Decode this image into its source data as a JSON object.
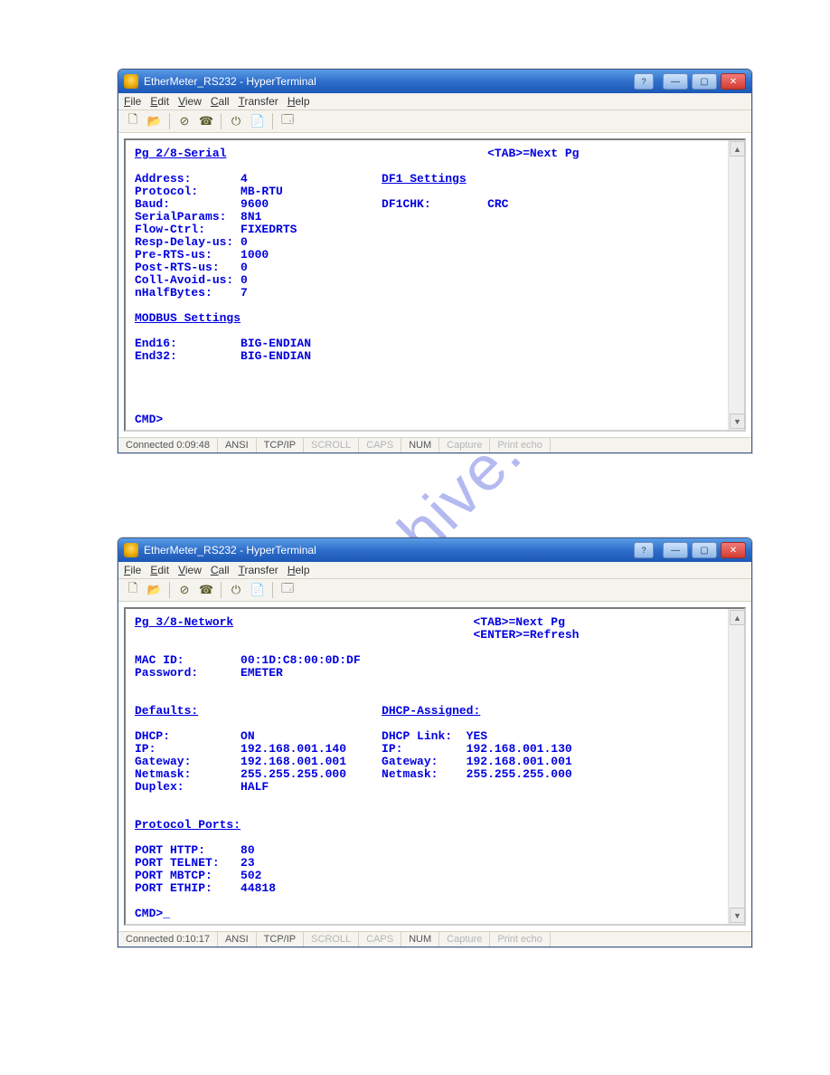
{
  "watermark": "manualshive.com",
  "menus": {
    "file": "File",
    "edit": "Edit",
    "view": "View",
    "call": "Call",
    "transfer": "Transfer",
    "help": "Help"
  },
  "window_controls": {
    "min": "—",
    "max": "▢",
    "close": "✕",
    "help": "?"
  },
  "toolbar_icons": {
    "new": "🗋",
    "open": "📂",
    "stop": "⊘",
    "call": "☎",
    "hangup": "⏻",
    "props": "📄",
    "config": "🗔"
  },
  "scroll": {
    "up": "▲",
    "down": "▼"
  },
  "win1": {
    "title": "EtherMeter_RS232 - HyperTerminal",
    "status": {
      "conn": "Connected 0:09:48",
      "enc": "ANSI",
      "proto": "TCP/IP",
      "scroll": "SCROLL",
      "caps": "CAPS",
      "num": "NUM",
      "capture": "Capture",
      "printecho": "Print echo"
    },
    "term": {
      "page_header": "Pg 2/8-Serial",
      "hint1": "<TAB>=Next Pg",
      "rows": [
        [
          "Address:",
          "4"
        ],
        [
          "Protocol:",
          "MB-RTU"
        ],
        [
          "Baud:",
          "9600"
        ],
        [
          "SerialParams:",
          "8N1"
        ],
        [
          "Flow-Ctrl:",
          "FIXEDRTS"
        ],
        [
          "Resp-Delay-us:",
          "0"
        ],
        [
          "Pre-RTS-us:",
          "1000"
        ],
        [
          "Post-RTS-us:",
          "0"
        ],
        [
          "Coll-Avoid-us:",
          "0"
        ],
        [
          "nHalfBytes:",
          "7"
        ]
      ],
      "df1_header": "DF1 Settings",
      "df1_row": [
        "DF1CHK:",
        "CRC"
      ],
      "modbus_header": "MODBUS Settings",
      "modbus_rows": [
        [
          "End16:",
          "BIG-ENDIAN"
        ],
        [
          "End32:",
          "BIG-ENDIAN"
        ]
      ],
      "prompt": "CMD>"
    }
  },
  "win2": {
    "title": "EtherMeter_RS232 - HyperTerminal",
    "status": {
      "conn": "Connected 0:10:17",
      "enc": "ANSI",
      "proto": "TCP/IP",
      "scroll": "SCROLL",
      "caps": "CAPS",
      "num": "NUM",
      "capture": "Capture",
      "printecho": "Print echo"
    },
    "term": {
      "page_header": "Pg 3/8-Network",
      "hint1": "<TAB>=Next Pg",
      "hint2": "<ENTER>=Refresh",
      "top_rows": [
        [
          "MAC ID:",
          "00:1D:C8:00:0D:DF"
        ],
        [
          "Password:",
          "EMETER"
        ]
      ],
      "defaults_header": "Defaults:",
      "dhcp_header": "DHCP-Assigned:",
      "defaults_rows": [
        [
          "DHCP:",
          "ON"
        ],
        [
          "IP:",
          "192.168.001.140"
        ],
        [
          "Gateway:",
          "192.168.001.001"
        ],
        [
          "Netmask:",
          "255.255.255.000"
        ],
        [
          "Duplex:",
          "HALF"
        ]
      ],
      "dhcp_rows": [
        [
          "DHCP Link:",
          "YES"
        ],
        [
          "IP:",
          "192.168.001.130"
        ],
        [
          "Gateway:",
          "192.168.001.001"
        ],
        [
          "Netmask:",
          "255.255.255.000"
        ]
      ],
      "ports_header": "Protocol Ports:",
      "ports_rows": [
        [
          "PORT HTTP:",
          "80"
        ],
        [
          "PORT TELNET:",
          "23"
        ],
        [
          "PORT MBTCP:",
          "502"
        ],
        [
          "PORT ETHIP:",
          "44818"
        ]
      ],
      "prompt": "CMD>"
    }
  }
}
